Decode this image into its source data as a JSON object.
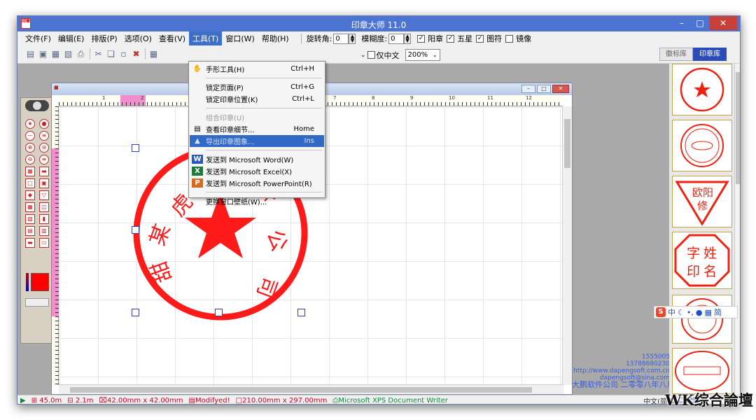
{
  "window": {
    "title": "印章大师 11.0",
    "icon_text": "印章"
  },
  "menubar": {
    "items": [
      "文件(F)",
      "编辑(E)",
      "排版(P)",
      "选项(O)",
      "查看(V)",
      "工具(T)",
      "窗口(W)",
      "帮助(H)"
    ],
    "rotation_label": "旋转角:",
    "rotation_value": "0",
    "blur_label": "模糊度:",
    "blur_value": "0",
    "checks": [
      {
        "label": "阳章",
        "checked": true
      },
      {
        "label": "五星",
        "checked": true
      },
      {
        "label": "图符",
        "checked": true
      },
      {
        "label": "镜像",
        "checked": false
      }
    ]
  },
  "toolbar": {
    "only_chinese_label": "仅中文",
    "zoom_value": "200%",
    "lib_tabs": [
      "徽标库",
      "印章库"
    ]
  },
  "dropdown": {
    "items": [
      {
        "icon": "hand-icon",
        "label": "手形工具(H)",
        "shortcut": "Ctrl+H",
        "state": "normal"
      },
      {
        "sep": true
      },
      {
        "icon": "",
        "label": "锁定页面(P)",
        "shortcut": "Ctrl+G",
        "state": "normal"
      },
      {
        "icon": "",
        "label": "锁定印章位置(K)",
        "shortcut": "Ctrl+L",
        "state": "normal"
      },
      {
        "sep": true
      },
      {
        "icon": "",
        "label": "组合印章(U)",
        "shortcut": "",
        "state": "disabled"
      },
      {
        "icon": "details-icon",
        "label": "查看印章细节...",
        "shortcut": "Home",
        "state": "normal"
      },
      {
        "icon": "export-icon",
        "label": "导出印章图象...",
        "shortcut": "Ins",
        "state": "hover"
      },
      {
        "sep": true
      },
      {
        "icon": "word-icon",
        "label": "发送到 Microsoft Word(W)",
        "shortcut": "",
        "state": "normal"
      },
      {
        "icon": "excel-icon",
        "label": "发送到 Microsoft Excel(X)",
        "shortcut": "",
        "state": "normal"
      },
      {
        "icon": "powerpoint-icon",
        "label": "发送到 Microsoft PowerPoint(R)",
        "shortcut": "",
        "state": "normal"
      },
      {
        "sep": true
      },
      {
        "icon": "",
        "label": "更换窗口壁纸(W)...",
        "shortcut": "",
        "state": "normal"
      }
    ]
  },
  "document": {
    "ruler_numbers": [
      "1",
      "2",
      "7",
      "8",
      "9",
      "10",
      "11",
      "12"
    ],
    "stamp_chars_visible": [
      "某",
      "虎",
      "件",
      "公",
      "司",
      "甜"
    ],
    "stamp_color": "#ff1a1a"
  },
  "contact": {
    "lines": [
      "1555005",
      "13788680230",
      "http://www.dapengsoft.com.cn",
      "dapengsoft@sina.com",
      "大鹏软件公司 二零零八年八月"
    ]
  },
  "library": {
    "thumb_texts": [
      "欧阳",
      "修",
      "字",
      "姓",
      "印",
      "名"
    ]
  },
  "ime": {
    "items": [
      "中",
      "•,",
      "简"
    ]
  },
  "statusbar": {
    "pos_x": "45.0m",
    "pos_y": "2.1m",
    "stamp_size": "42.00mm x 42.00mm",
    "modified": "Modifyed!",
    "paper_size": "210.00mm x 297.00mm",
    "printer": "Microsoft XPS Document Writer",
    "ime_state": "中文(简体)",
    "caps": "CAPS"
  },
  "watermark": "WK综合論壇"
}
